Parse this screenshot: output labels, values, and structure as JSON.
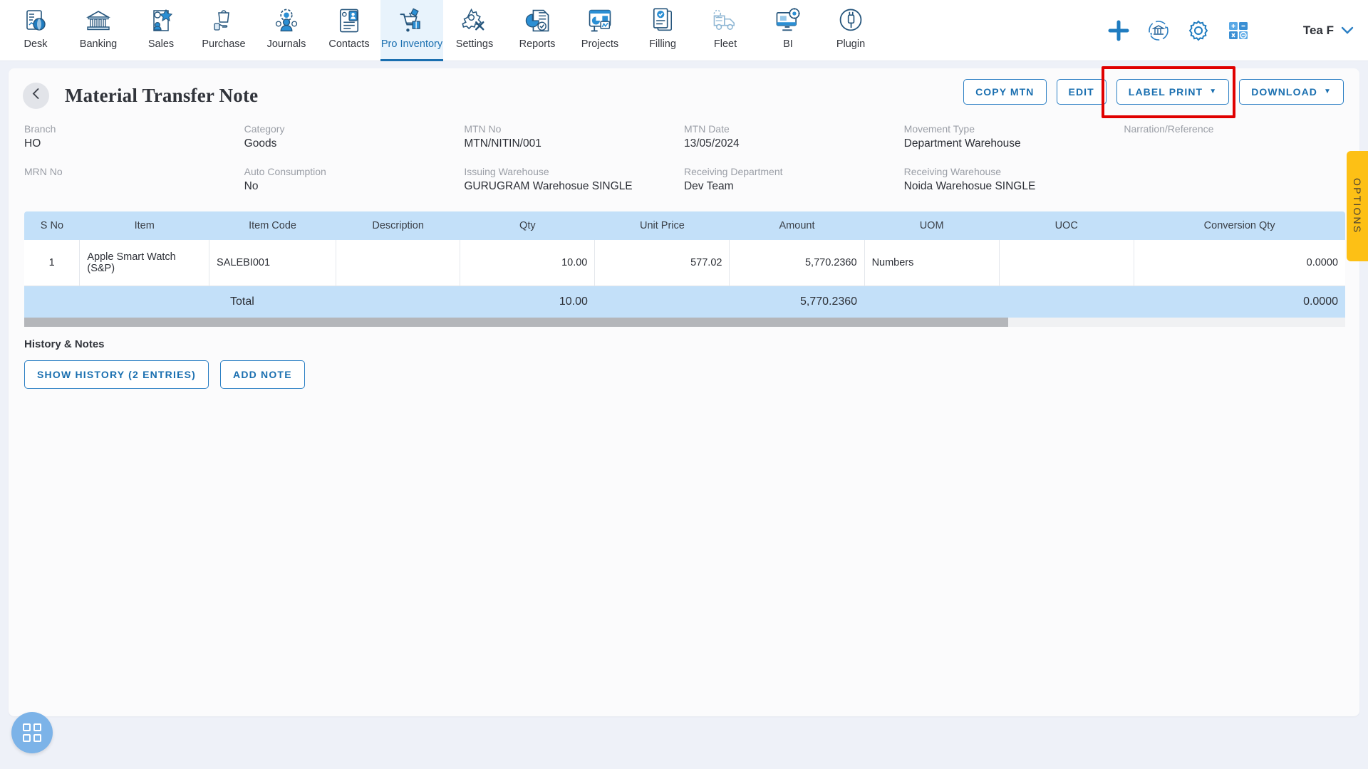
{
  "nav": {
    "items": [
      {
        "label": "Desk",
        "icon": "desk-icon",
        "active": false
      },
      {
        "label": "Banking",
        "icon": "bank-icon",
        "active": false
      },
      {
        "label": "Sales",
        "icon": "sales-icon",
        "active": false
      },
      {
        "label": "Purchase",
        "icon": "purchase-icon",
        "active": false
      },
      {
        "label": "Journals",
        "icon": "journals-icon",
        "active": false
      },
      {
        "label": "Contacts",
        "icon": "contacts-icon",
        "active": false
      },
      {
        "label": "Pro Inventory",
        "icon": "inventory-cart-icon",
        "active": true
      },
      {
        "label": "Settings",
        "icon": "settings-gear-wrench-icon",
        "active": false
      },
      {
        "label": "Reports",
        "icon": "reports-piechart-icon",
        "active": false
      },
      {
        "label": "Projects",
        "icon": "projects-dashboard-icon",
        "active": false
      },
      {
        "label": "Filling",
        "icon": "filling-document-check-icon",
        "active": false
      },
      {
        "label": "Fleet",
        "icon": "fleet-truck-icon",
        "active": false
      },
      {
        "label": "BI",
        "icon": "bi-monitor-icon",
        "active": false
      },
      {
        "label": "Plugin",
        "icon": "plugin-plug-icon",
        "active": false
      }
    ],
    "right_icons": [
      {
        "name": "add-plus-icon"
      },
      {
        "name": "bank-sync-icon"
      },
      {
        "name": "settings-gear-icon"
      },
      {
        "name": "calculator-icon"
      }
    ],
    "user": {
      "name": "Tea F",
      "chevron": "⌄"
    }
  },
  "page": {
    "back_icon": "chevron-left-icon",
    "title": "Material Transfer Note"
  },
  "actions": {
    "copy_mtn": "COPY MTN",
    "edit": "EDIT",
    "label_print": "LABEL PRINT",
    "download": "DOWNLOAD",
    "caret": "▼",
    "highlighted": "LABEL PRINT",
    "highlight_color": "#e00000"
  },
  "details": [
    {
      "label": "Branch",
      "value": "HO"
    },
    {
      "label": "Category",
      "value": "Goods"
    },
    {
      "label": "MTN No",
      "value": "MTN/NITIN/001"
    },
    {
      "label": "MTN Date",
      "value": "13/05/2024"
    },
    {
      "label": "Movement Type",
      "value": "Department Warehouse"
    },
    {
      "label": "Narration/Reference",
      "value": ""
    },
    {
      "label": "MRN No",
      "value": ""
    },
    {
      "label": "Auto Consumption",
      "value": "No"
    },
    {
      "label": "Issuing Warehouse",
      "value": "GURUGRAM Warehosue SINGLE"
    },
    {
      "label": "Receiving Department",
      "value": "Dev Team"
    },
    {
      "label": "Receiving Warehouse",
      "value": "Noida Warehosue SINGLE"
    },
    {
      "label": "",
      "value": ""
    }
  ],
  "table": {
    "columns": [
      "S No",
      "Item",
      "Item Code",
      "Description",
      "Qty",
      "Unit Price",
      "Amount",
      "UOM",
      "UOC",
      "Conversion Qty"
    ],
    "rows": [
      {
        "s_no": "1",
        "item": "Apple Smart Watch (S&P)",
        "item_code": "SALEBI001",
        "description": "",
        "qty": "10.00",
        "unit_price": "577.02",
        "amount": "5,770.2360",
        "uom": "Numbers",
        "uoc": "",
        "conversion_qty": "0.0000"
      }
    ],
    "total": {
      "label": "Total",
      "qty": "10.00",
      "amount": "5,770.2360",
      "conversion_qty": "0.0000"
    }
  },
  "history": {
    "title": "History & Notes",
    "show_history": "SHOW HISTORY (2 ENTRIES)",
    "add_note": "ADD NOTE"
  },
  "options_tab": {
    "label": "OPTIONS",
    "color": "#fdc015"
  },
  "fab": {
    "icon": "grid-apps-icon",
    "color": "#7cb3e8"
  }
}
